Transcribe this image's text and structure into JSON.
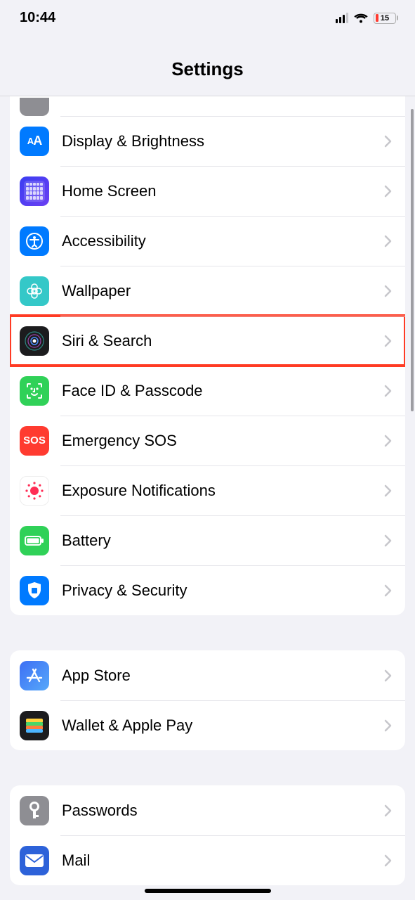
{
  "status": {
    "time": "10:44",
    "battery_pct": "15"
  },
  "header": {
    "title": "Settings"
  },
  "group1": {
    "items": [
      {
        "label": ""
      },
      {
        "label": "Display & Brightness"
      },
      {
        "label": "Home Screen"
      },
      {
        "label": "Accessibility"
      },
      {
        "label": "Wallpaper"
      },
      {
        "label": "Siri & Search"
      },
      {
        "label": "Face ID & Passcode"
      },
      {
        "label": "Emergency SOS"
      },
      {
        "label": "Exposure Notifications"
      },
      {
        "label": "Battery"
      },
      {
        "label": "Privacy & Security"
      }
    ]
  },
  "group2": {
    "items": [
      {
        "label": "App Store"
      },
      {
        "label": "Wallet & Apple Pay"
      }
    ]
  },
  "group3": {
    "items": [
      {
        "label": "Passwords"
      },
      {
        "label": "Mail"
      }
    ]
  }
}
